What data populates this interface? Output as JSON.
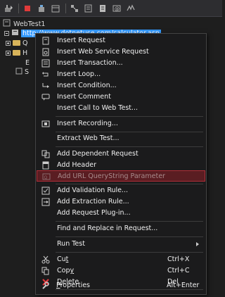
{
  "tree": {
    "root_label": "WebTest1",
    "request_url": "http://www.dotnetuse.com/calculator.asp",
    "child_labels": [
      "Q",
      "H",
      "E",
      "S"
    ]
  },
  "menu": {
    "items": [
      {
        "label": "Insert Request"
      },
      {
        "label": "Insert Web Service Request"
      },
      {
        "label": "Insert Transaction..."
      },
      {
        "label": "Insert Loop..."
      },
      {
        "label": "Insert Condition..."
      },
      {
        "label": "Insert Comment"
      },
      {
        "label": "Insert Call to Web Test..."
      },
      {
        "label": "Insert Recording..."
      },
      {
        "label": "Extract Web Test..."
      },
      {
        "label": "Add Dependent Request"
      },
      {
        "label": "Add Header"
      },
      {
        "label": "Add URL QueryString Parameter"
      },
      {
        "label": "Add Validation Rule..."
      },
      {
        "label": "Add Extraction Rule..."
      },
      {
        "label": "Add Request Plug-in..."
      },
      {
        "label": "Find and Replace in Request..."
      },
      {
        "label": "Run Test"
      }
    ],
    "cut": {
      "pre": "Cu",
      "ul": "t",
      "post": "",
      "shortcut": "Ctrl+X"
    },
    "copy": {
      "pre": "Cop",
      "ul": "y",
      "post": "",
      "shortcut": "Ctrl+C"
    },
    "delete": {
      "pre": "",
      "ul": "D",
      "post": "elete",
      "shortcut": "Del"
    },
    "properties": {
      "pre": "",
      "ul": "P",
      "post": "roperties",
      "shortcut": "Alt+Enter"
    }
  },
  "colors": {
    "highlight_bg": "#5a1d22",
    "highlight_border": "#b02e38",
    "selection": "#3399ff"
  }
}
